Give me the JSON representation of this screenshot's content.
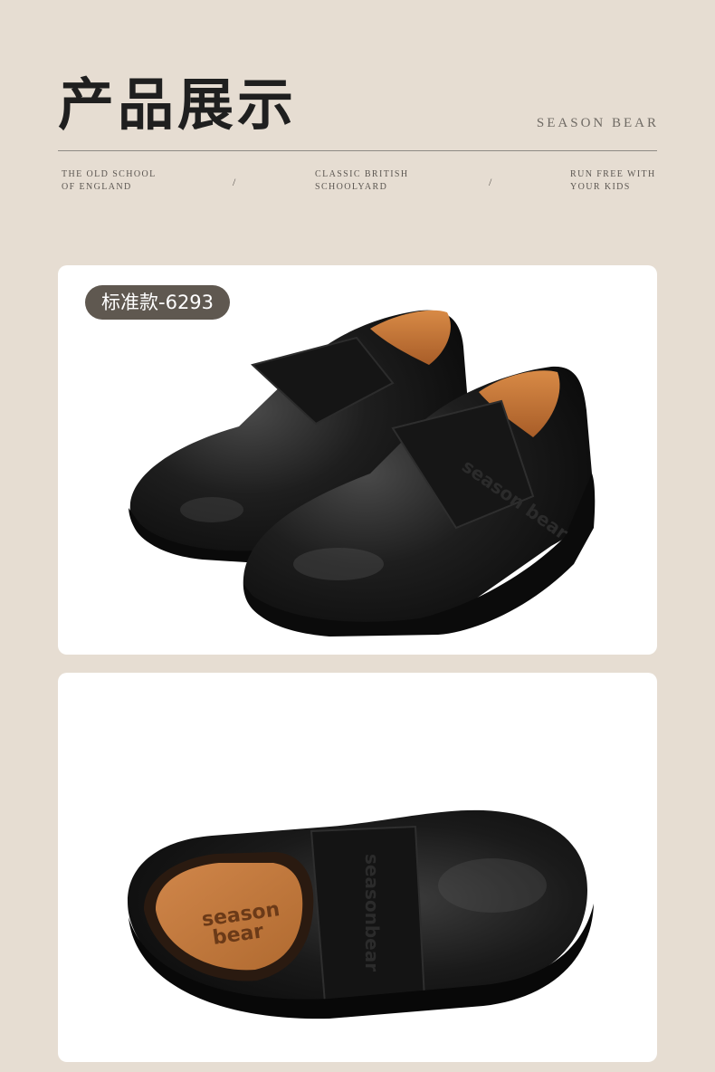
{
  "header": {
    "title": "产品展示",
    "brand": "SEASON BEAR",
    "taglines": [
      {
        "line1": "THE OLD SCHOOL",
        "line2": "OF ENGLAND"
      },
      {
        "line1": "CLASSIC BRITISH",
        "line2": "SCHOOLYARD"
      },
      {
        "line1": "RUN FREE WITH",
        "line2": "YOUR KIDS"
      }
    ],
    "separator": "/"
  },
  "products": [
    {
      "badge": "标准款-6293",
      "image": "black-leather-velcro-school-shoes-pair"
    },
    {
      "image": "black-leather-velcro-school-shoe-side-view",
      "insole_logo_line1": "season",
      "insole_logo_line2": "bear"
    }
  ],
  "colors": {
    "background": "#e6ddd2",
    "card": "#ffffff",
    "badge": "#5f5850",
    "leather": "#1a1a1a",
    "lining": "#c87a3c"
  }
}
